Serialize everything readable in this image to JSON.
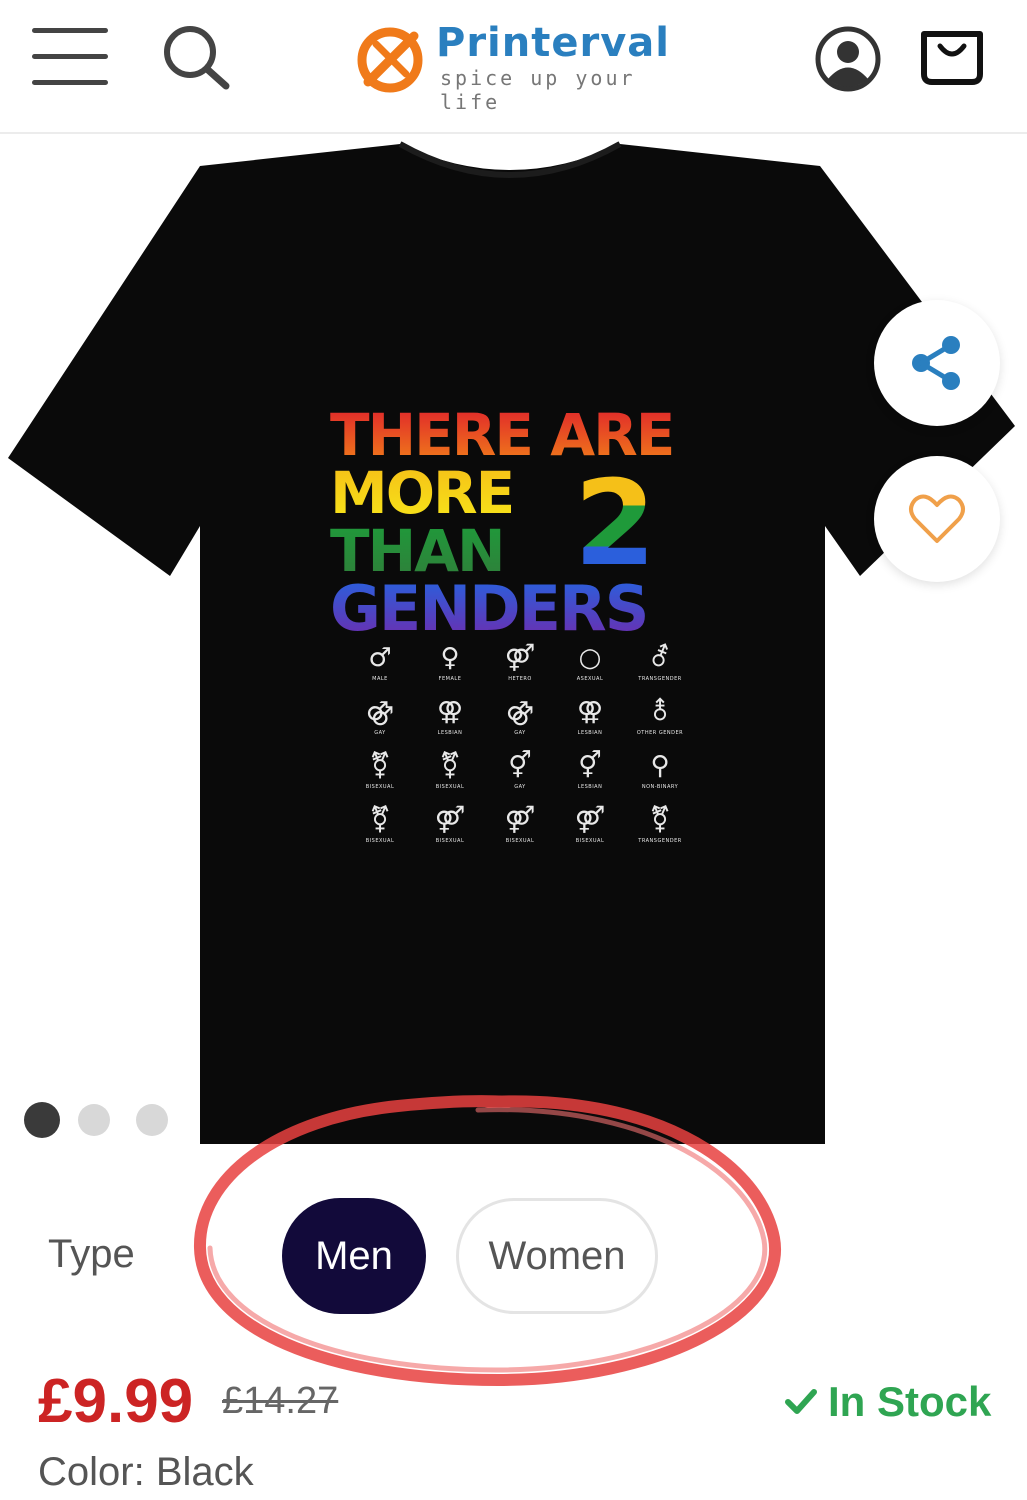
{
  "header": {
    "brand_name": "Printerval",
    "brand_tagline": "spice up your life",
    "brand_color": "#2a7fbf",
    "logo_mark_color": "#f07a1a",
    "icons": [
      "menu-icon",
      "search-icon",
      "account-icon",
      "cart-icon"
    ]
  },
  "product_image": {
    "design_text": {
      "line1": "THERE ARE",
      "line2": "MORE",
      "line3": "THAN",
      "line4": "GENDERS",
      "number": "2"
    },
    "symbols": [
      {
        "glyph": "♂",
        "label": "MALE"
      },
      {
        "glyph": "♀",
        "label": "FEMALE"
      },
      {
        "glyph": "⚤",
        "label": "HETERO"
      },
      {
        "glyph": "○",
        "label": "ASEXUAL"
      },
      {
        "glyph": "⚦",
        "label": "TRANSGENDER"
      },
      {
        "glyph": "⚣",
        "label": "GAY"
      },
      {
        "glyph": "⚢",
        "label": "LESBIAN"
      },
      {
        "glyph": "⚣",
        "label": "GAY"
      },
      {
        "glyph": "⚢",
        "label": "LESBIAN"
      },
      {
        "glyph": "⚨",
        "label": "OTHER GENDER"
      },
      {
        "glyph": "⚧",
        "label": "BISEXUAL"
      },
      {
        "glyph": "⚧",
        "label": "BISEXUAL"
      },
      {
        "glyph": "⚥",
        "label": "GAY"
      },
      {
        "glyph": "⚥",
        "label": "LESBIAN"
      },
      {
        "glyph": "⚲",
        "label": "NON-BINARY"
      },
      {
        "glyph": "⚧",
        "label": "BISEXUAL"
      },
      {
        "glyph": "⚤",
        "label": "BISEXUAL"
      },
      {
        "glyph": "⚤",
        "label": "BISEXUAL"
      },
      {
        "glyph": "⚤",
        "label": "BISEXUAL"
      },
      {
        "glyph": "⚧",
        "label": "TRANSGENDER"
      }
    ],
    "carousel_count": 3,
    "carousel_active_index": 0,
    "share_icon": "share-icon",
    "wishlist_icon": "heart-icon"
  },
  "type_selector": {
    "label": "Type",
    "options": [
      "Men",
      "Women"
    ],
    "selected": "Men"
  },
  "pricing": {
    "price": "£9.99",
    "original_price": "£14.27",
    "stock_status": "In Stock"
  },
  "color": {
    "label": "Color:",
    "value": "Black"
  },
  "colors": {
    "price": "#cc2424",
    "stock": "#2fa552",
    "selected_option_bg": "#120a3a",
    "annotation_circle": "#e8413f"
  }
}
